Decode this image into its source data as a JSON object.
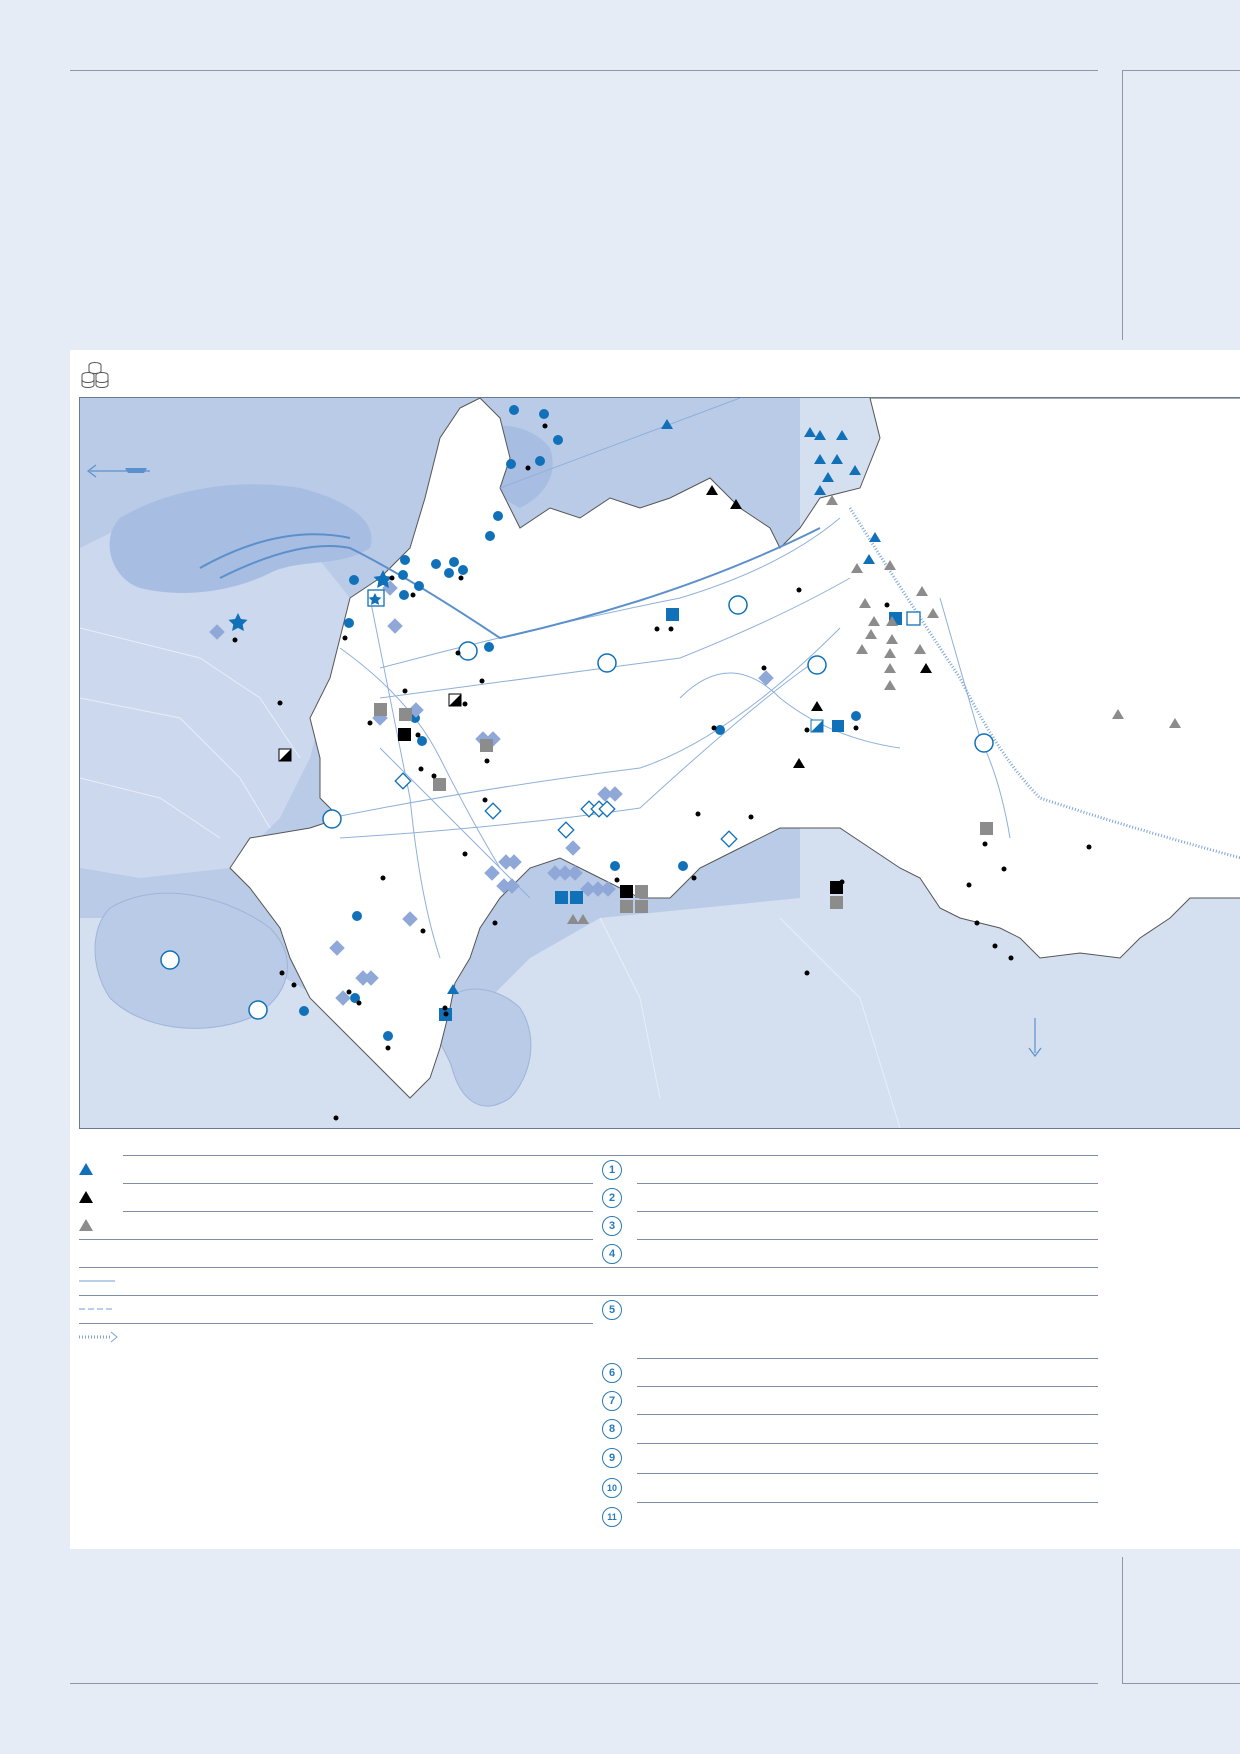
{
  "colors": {
    "page_bg": "#e6ecf6",
    "map_water": "#b9cbe6",
    "map_land_outside": "#d4dff0",
    "map_region": "#ffffff",
    "accent_blue": "#1070b8",
    "marker_gray": "#8c8c8c",
    "marker_black": "#000000",
    "light_diamond": "#8fa8d8"
  },
  "header_icon": "database-stack-icon",
  "legend_left": {
    "symbols": [
      "triangle-blue",
      "triangle-black",
      "triangle-gray",
      "blank",
      "pipeline-solid",
      "pipeline-dashed",
      "pipeline-arrow"
    ]
  },
  "legend_right": {
    "numbers": [
      "1",
      "2",
      "3",
      "4",
      "5",
      "6",
      "7",
      "8",
      "9",
      "10",
      "11"
    ]
  }
}
